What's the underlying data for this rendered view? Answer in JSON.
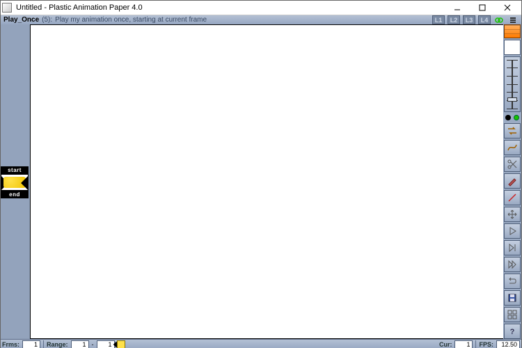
{
  "window": {
    "title": "Untitled - Plastic Animation Paper 4.0"
  },
  "hint": {
    "command": "Play_Once",
    "key": "(5):",
    "desc": "Play my animation once, starting at current frame"
  },
  "layers": {
    "l1": "L1",
    "l2": "L2",
    "l3": "L3",
    "l4": "L4"
  },
  "left": {
    "start": "start",
    "end": "end"
  },
  "status": {
    "frms_label": "Frms:",
    "frms_val": "1",
    "range_label": "Range:",
    "range_from": "1",
    "range_sep": "-",
    "range_to": "1",
    "cur_label": "Cur:",
    "cur_val": "1",
    "fps_label": "FPS:",
    "fps_val": "12.50"
  },
  "tool_names": {
    "colorwell": "color-well",
    "slider": "brush-size-slider",
    "dots": "pen-mode-dots",
    "swap": "swap-tool",
    "smooth": "smooth-tool",
    "cut": "cut-tool",
    "pencil": "pencil-tool",
    "line": "line-tool",
    "move": "move-tool",
    "play": "play-button",
    "next": "next-frame-button",
    "last": "last-frame-button",
    "loop": "loop-button",
    "save": "save-button",
    "grid": "grid-button",
    "help": "help-button"
  }
}
